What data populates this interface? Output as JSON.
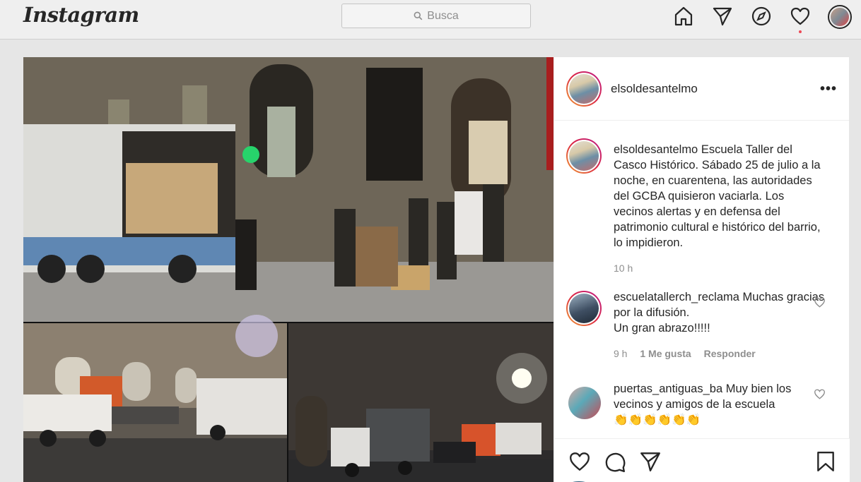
{
  "app": {
    "logo": "Instagram",
    "search_placeholder": "Busca",
    "nav_icons": [
      "home-icon",
      "direct-icon",
      "explore-icon",
      "activity-heart-icon",
      "profile-avatar"
    ]
  },
  "post": {
    "author": "elsoldesantelmo",
    "more_label": "•••",
    "caption": {
      "username": "elsoldesantelmo",
      "text": " Escuela Taller del Casco Histórico. Sábado 25 de julio a la noche, en cuarentena, las autoridades del GCBA quisieron vaciarla. Los vecinos alertas y en defensa del patrimonio cultural e histórico del barrio, lo impidieron.",
      "time": "10 h"
    },
    "comments": [
      {
        "username": "escuelatallerch_reclama",
        "text": " Muchas gracias por la difusión.",
        "text2": "Un gran abrazo!!!!!",
        "time": "9 h",
        "likes": "1 Me gusta",
        "reply": "Responder"
      },
      {
        "username": "puertas_antiguas_ba",
        "text": " Muy bien los vecinos y amigos de la escuela",
        "emoji": "👏👏👏👏👏👏"
      }
    ]
  },
  "colors": {
    "gradient_ring": "#dc2743",
    "notification_dot": "#ed4956",
    "muted": "#8e8e8e"
  }
}
